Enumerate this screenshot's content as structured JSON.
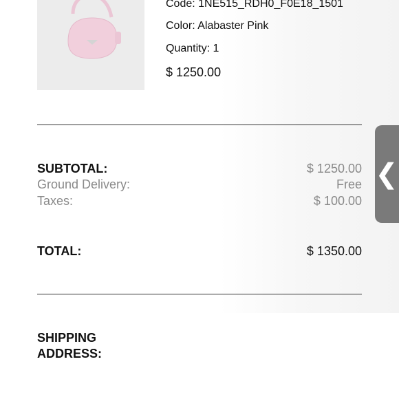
{
  "product": {
    "code": "Code: 1NE515_RDH0_F0E18_1501",
    "color": "Color: Alabaster Pink",
    "quantity": "Quantity: 1",
    "price": "$ 1250.00"
  },
  "summary": {
    "subtotal_label": "SUBTOTAL:",
    "subtotal_value": "$ 1250.00",
    "delivery_label": "Ground Delivery:",
    "delivery_value": "Free",
    "taxes_label": "Taxes:",
    "taxes_value": "$ 100.00",
    "total_label": "TOTAL:",
    "total_value": "$ 1350.00"
  },
  "shipping": {
    "heading": "SHIPPING ADDRESS:"
  },
  "side_tab": {
    "icon": "chevron-left-icon",
    "glyph": "❮"
  },
  "colors": {
    "bag": "#f1cfdc",
    "tab": "#7a7a7a"
  }
}
